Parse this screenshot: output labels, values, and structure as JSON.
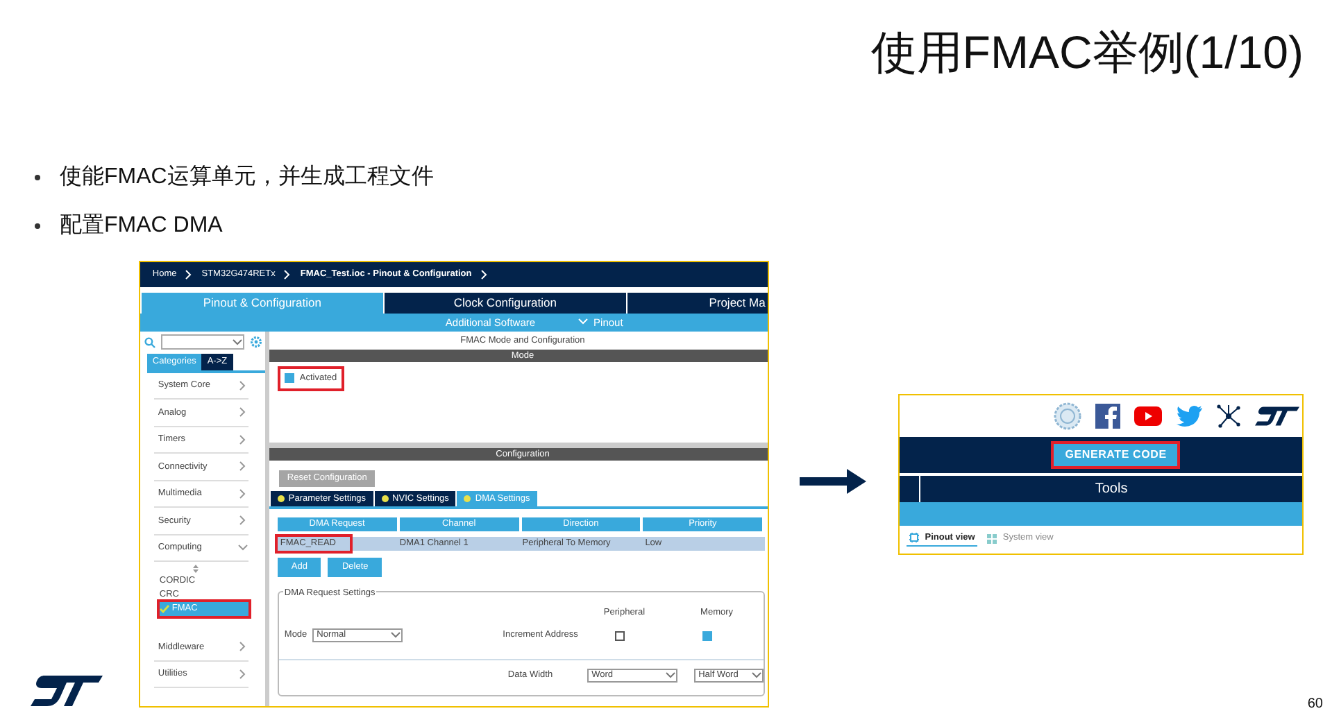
{
  "slide": {
    "title": "使用FMAC举例(1/10)",
    "bullets": [
      "使能FMAC运算单元，并生成工程文件",
      "配置FMAC DMA"
    ],
    "page_number": "60"
  },
  "cubemx_config": {
    "breadcrumbs": [
      {
        "label": "Home",
        "current": false
      },
      {
        "label": "STM32G474RETx",
        "current": false
      },
      {
        "label": "FMAC_Test.ioc - Pinout & Configuration",
        "current": true
      }
    ],
    "main_tabs": [
      {
        "label": "Pinout & Configuration",
        "selected": true
      },
      {
        "label": "Clock Configuration",
        "selected": false
      },
      {
        "label": "Project Ma",
        "selected": false
      }
    ],
    "sub_menu": [
      {
        "label": "Additional Software",
        "kind": "plain"
      },
      {
        "label": "Pinout",
        "kind": "dropdown"
      }
    ],
    "sidebar": {
      "tabs": [
        {
          "label": "Categories",
          "selected": true
        },
        {
          "label": "A->Z",
          "selected": false
        }
      ],
      "categories": [
        {
          "label": "System Core",
          "expanded": false
        },
        {
          "label": "Analog",
          "expanded": false
        },
        {
          "label": "Timers",
          "expanded": false
        },
        {
          "label": "Connectivity",
          "expanded": false
        },
        {
          "label": "Multimedia",
          "expanded": false
        },
        {
          "label": "Security",
          "expanded": false
        },
        {
          "label": "Computing",
          "expanded": true,
          "children": [
            {
              "label": "CORDIC",
              "selected": false,
              "checked": false,
              "highlighted": false
            },
            {
              "label": "CRC",
              "selected": false,
              "checked": false,
              "highlighted": false
            },
            {
              "label": "FMAC",
              "selected": true,
              "checked": true,
              "highlighted": true
            }
          ]
        },
        {
          "label": "Middleware",
          "expanded": false
        },
        {
          "label": "Utilities",
          "expanded": false
        }
      ]
    },
    "panel_title": "FMAC Mode and Configuration",
    "mode": {
      "header": "Mode",
      "activated": {
        "label": "Activated",
        "checked": true,
        "highlighted": true
      }
    },
    "configuration": {
      "header": "Configuration",
      "reset_button": "Reset Configuration",
      "tabs": [
        {
          "label": "Parameter Settings",
          "selected": false
        },
        {
          "label": "NVIC Settings",
          "selected": false
        },
        {
          "label": "DMA Settings",
          "selected": true
        }
      ],
      "dma_table": {
        "columns": [
          "DMA Request",
          "Channel",
          "Direction",
          "Priority"
        ],
        "rows": [
          {
            "cells": [
              "FMAC_READ",
              "DMA1 Channel 1",
              "Peripheral To Memory",
              "Low"
            ],
            "selected": true,
            "highlighted": true
          }
        ]
      },
      "buttons": [
        "Add",
        "Delete"
      ],
      "request_settings": {
        "title": "DMA Request Settings",
        "mode_label": "Mode",
        "mode_value": "Normal",
        "peripheral_header": "Peripheral",
        "memory_header": "Memory",
        "increment_label": "Increment Address",
        "increment_peripheral": false,
        "increment_memory": true,
        "data_width_label": "Data Width",
        "data_width_peripheral": "Word",
        "data_width_memory": "Half Word"
      }
    }
  },
  "cubemx_toolbar": {
    "generate_button": {
      "label": "GENERATE CODE",
      "highlighted": true
    },
    "tools_tab": "Tools",
    "view_tabs": [
      {
        "label": "Pinout view",
        "selected": true
      },
      {
        "label": "System view",
        "selected": false
      }
    ]
  }
}
